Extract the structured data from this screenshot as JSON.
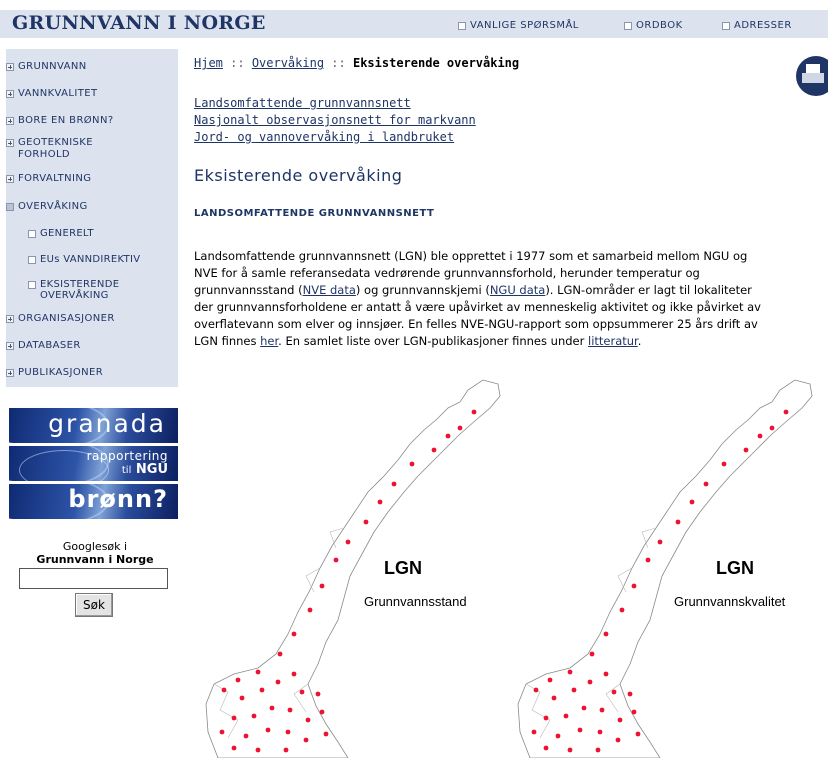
{
  "header": {
    "site_title": "GRUNNVANN I NORGE",
    "links": [
      "VANLIGE SPØRSMÅL",
      "ORDBOK",
      "ADRESSER"
    ]
  },
  "sidebar": {
    "items": [
      {
        "label": "GRUNNVANN"
      },
      {
        "label": "VANNKVALITET"
      },
      {
        "label": "BORE EN BRØNN?"
      },
      {
        "label": "GEOTEKNISKE FORHOLD"
      },
      {
        "label": "FORVALTNING"
      },
      {
        "label": "OVERVÅKING"
      },
      {
        "label": "ORGANISASJONER"
      },
      {
        "label": "DATABASER"
      },
      {
        "label": "PUBLIKASJONER"
      }
    ],
    "subitems": [
      {
        "label": "GENERELT"
      },
      {
        "label": "EUs VANNDIREKTIV"
      },
      {
        "label": "EKSISTERENDE OVERVÅKING"
      }
    ]
  },
  "banners": {
    "granada": "granada",
    "rapportering_line1": "rapportering",
    "rapportering_til": "til",
    "rapportering_ngu": "NGU",
    "bronn": "brønn?"
  },
  "search": {
    "label_line1": "Googlesøk i",
    "label_line2": "Grunnvann i Norge",
    "value": "",
    "button": "Søk"
  },
  "breadcrumb": {
    "home": "Hjem",
    "sep": " :: ",
    "parent": "Overvåking",
    "current": "Eksisterende overvåking"
  },
  "quicklinks": [
    "Landsomfattende grunnvannsnett",
    "Nasjonalt observasjonsnett for markvann",
    "Jord- og vannovervåking i landbruket"
  ],
  "main": {
    "heading": "Eksisterende overvåking",
    "subheading": "LANDSOMFATTENDE GRUNNVANNSNETT",
    "paragraph": {
      "l1": "Landsomfattende grunnvannsnett (LGN) ble opprettet i 1977 som et samarbeid mellom NGU og",
      "l2": "NVE for å samle referansedata vedrørende grunnvannsforhold, herunder temperatur og",
      "l3a": "grunnvannsstand (",
      "l3_link1": "NVE data",
      "l3b": ") og grunnvannskjemi (",
      "l3_link2": "NGU data",
      "l3c": "). LGN-områder er lagt til lokaliteter",
      "l4": "der grunnvannsforholdene er antatt å være upåvirket av menneskelig aktivitet og ikke påvirket av",
      "l5": "overflatevann som elver og innsjøer. En felles NVE-NGU-rapport som oppsummerer 25 års drift av",
      "l6a": "LGN finnes ",
      "l6_link1": "her",
      "l6b": ". En samlet liste over LGN-publikasjoner finnes under ",
      "l6_link2": "litteratur",
      "l6c": "."
    }
  },
  "maps": {
    "left": {
      "title": "LGN",
      "subtitle": "Grunnvannsstand"
    },
    "right": {
      "title": "LGN",
      "subtitle": "Grunnvannskvalitet"
    },
    "dot_color": "#ee1133"
  }
}
